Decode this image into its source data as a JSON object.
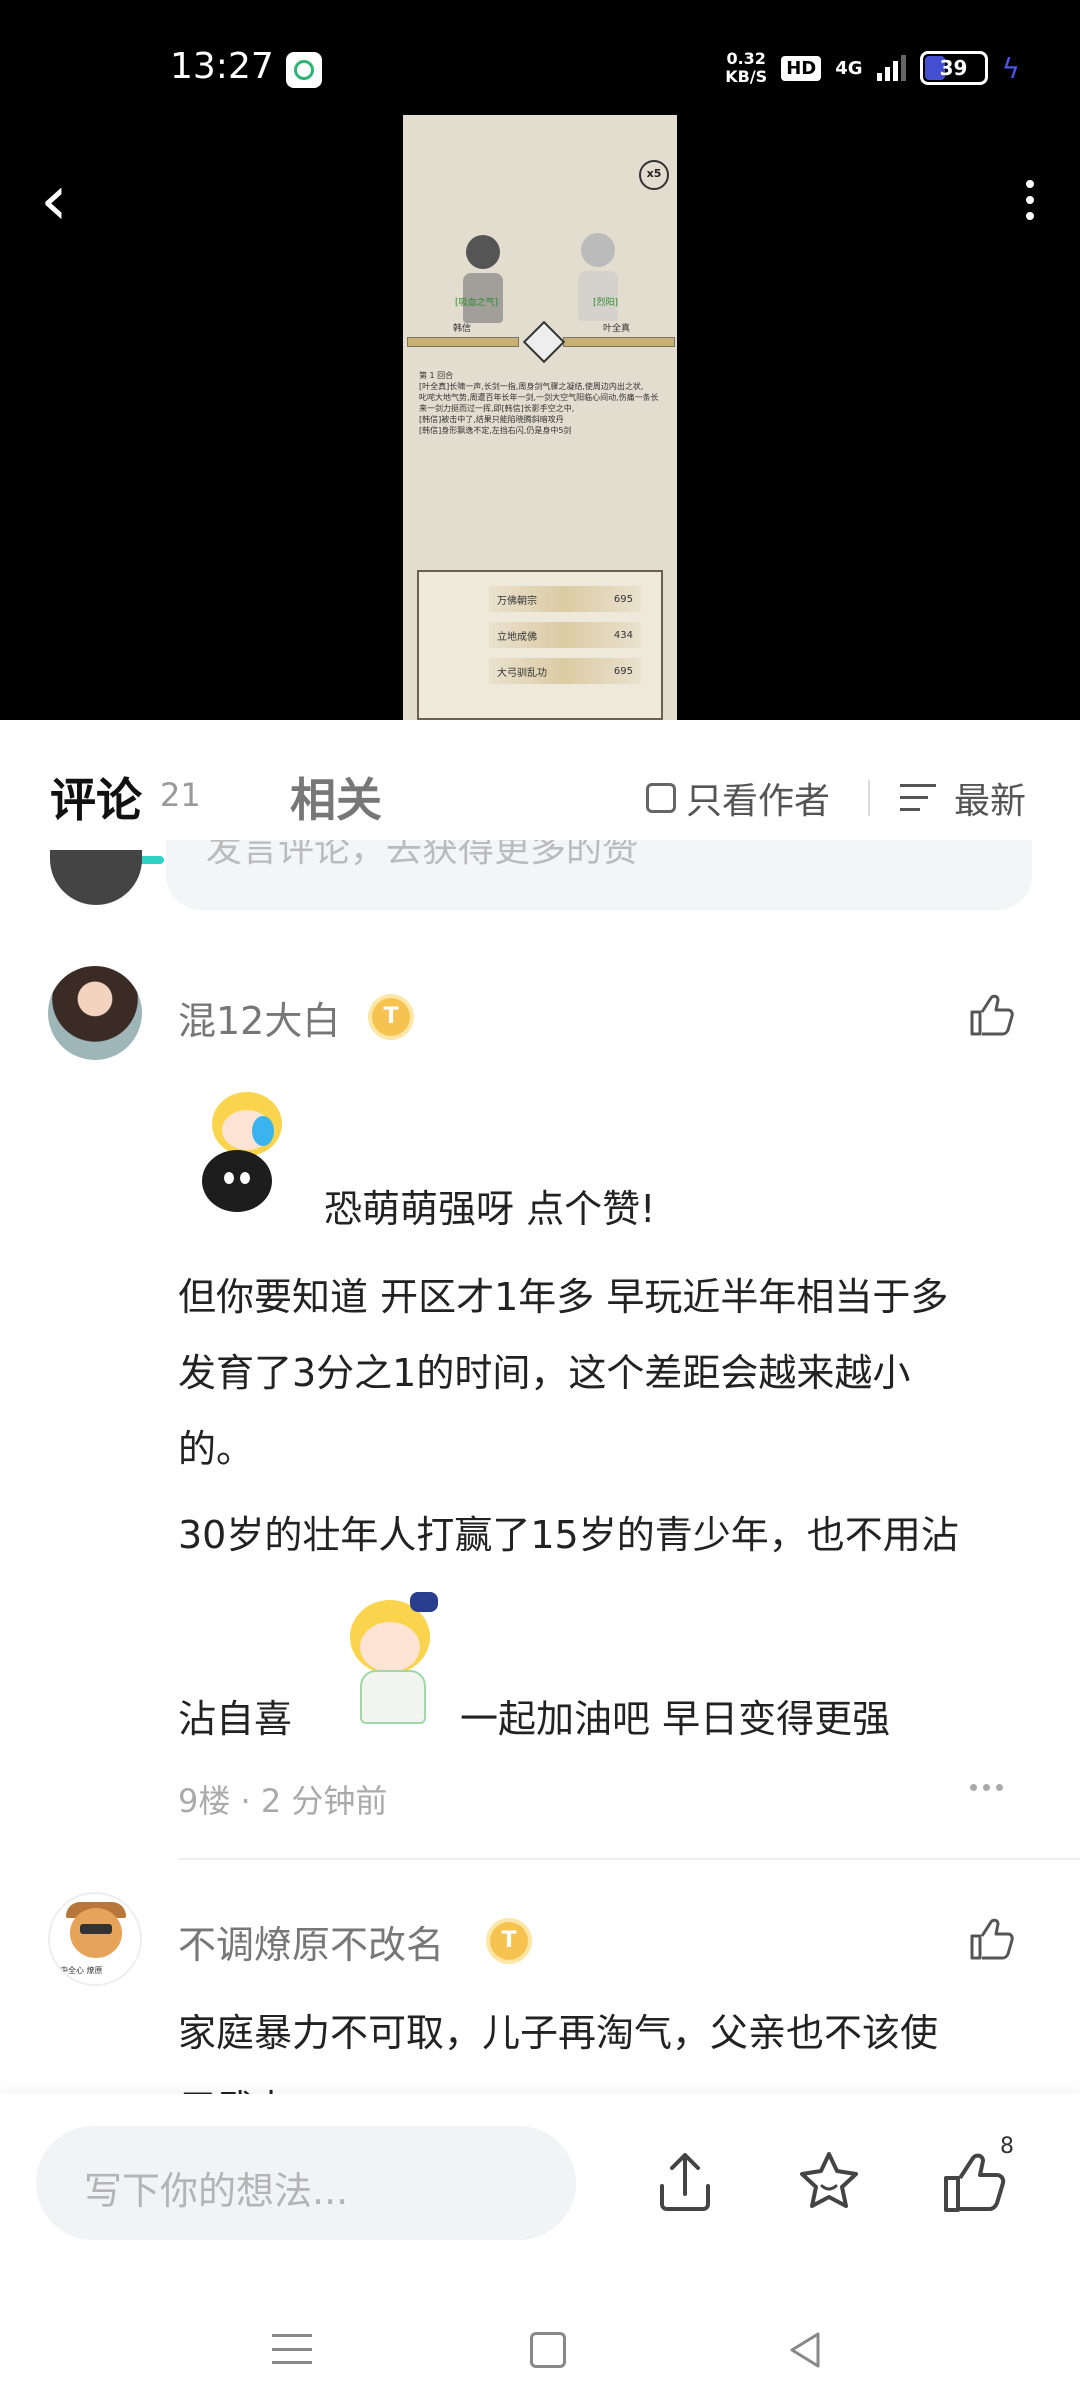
{
  "status_bar": {
    "time": "13:27",
    "net_speed_value": "0.32",
    "net_speed_unit": "KB/S",
    "hd": "HD",
    "network": "4G",
    "battery": "39"
  },
  "video": {
    "game": {
      "multiplier": "x5",
      "left_name_tag": "[吸血之气]",
      "right_name_tag": "[烈阳]",
      "left_name": "韩信",
      "right_name": "叶全真",
      "log": [
        "第 1 回合",
        "[叶全真]长啸一声,长剑一指,周身剑气骤之凝结,使周边内出之状,",
        "叱咤大地气势,周遭百年长年一剑,一剑大空气阳临心间动,伤痛一条长",
        "来一剑力挺而过一挥,即[韩信]长影手空之中,",
        "[韩信]被击中了,结果只能陷晓腾斜暗攻丹",
        "[韩信]身形飘逸不定,左挡右闪,仍是身中5剑"
      ],
      "skills": [
        {
          "name": "万佛朝宗",
          "value": "695"
        },
        {
          "name": "立地成佛",
          "value": "434"
        },
        {
          "name": "大弓驯乱功",
          "value": "695"
        }
      ]
    }
  },
  "tabs": {
    "comments_label": "评论",
    "comments_count": "21",
    "related_label": "相关",
    "author_only_label": "只看作者",
    "sort_label": "最新"
  },
  "peek_input": {
    "placeholder": "发言评论，去获得更多的赞"
  },
  "comments": [
    {
      "username": "混12大白",
      "badge": "T",
      "sticker_text": "恐萌萌强呀 点个赞!",
      "paragraphs": [
        "但你要知道 开区才1年多 早玩近半年相当于多",
        "发育了3分之1的时间，这个差距会越来越小",
        "的。",
        "30岁的壮年人打赢了15岁的青少年，也不用沾"
      ],
      "line_before_sticker": "沾自喜",
      "line_after_sticker": "一起加油吧 早日变得更强",
      "meta": "9楼 · 2 分钟前"
    },
    {
      "username": "不调燎原不改名",
      "badge": "T",
      "avatar_caption": "中全心 燎原",
      "paragraphs": [
        "家庭暴力不可取，儿子再淘气，父亲也不该使",
        "用武力"
      ]
    }
  ],
  "bottom_bar": {
    "input_placeholder": "写下你的想法...",
    "like_count": "8"
  },
  "colors": {
    "accent": "#2fd1c4",
    "badge": "#f6c351",
    "battery_charge": "#4a56e8"
  }
}
